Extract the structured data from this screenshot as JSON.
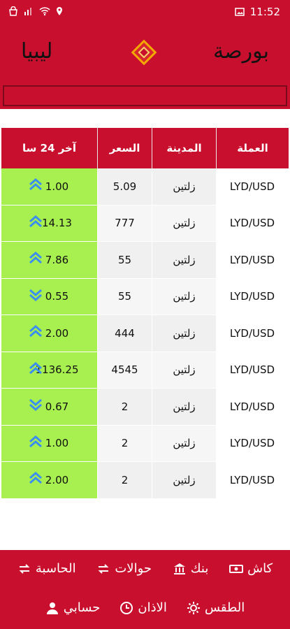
{
  "statusbar": {
    "time": "11:52"
  },
  "header": {
    "title_right": "بورصة",
    "title_left": "ليبيا"
  },
  "table": {
    "headers": {
      "currency": "العملة",
      "city": "المدينة",
      "price": "السعر",
      "change": "آخر 24 سا"
    },
    "rows": [
      {
        "currency": "LYD/USD",
        "city": "زلتين",
        "price": "5.09",
        "change": "1.00",
        "direction": "up"
      },
      {
        "currency": "LYD/USD",
        "city": "زلتين",
        "price": "777",
        "change": "14.13",
        "direction": "up"
      },
      {
        "currency": "LYD/USD",
        "city": "زلتين",
        "price": "55",
        "change": "7.86",
        "direction": "up"
      },
      {
        "currency": "LYD/USD",
        "city": "زلتين",
        "price": "55",
        "change": "0.55",
        "direction": "down"
      },
      {
        "currency": "LYD/USD",
        "city": "زلتين",
        "price": "444",
        "change": "2.00",
        "direction": "up"
      },
      {
        "currency": "LYD/USD",
        "city": "زلتين",
        "price": "4545",
        "change": "1136.25",
        "direction": "up"
      },
      {
        "currency": "LYD/USD",
        "city": "زلتين",
        "price": "2",
        "change": "0.67",
        "direction": "down"
      },
      {
        "currency": "LYD/USD",
        "city": "زلتين",
        "price": "2",
        "change": "1.00",
        "direction": "up"
      },
      {
        "currency": "LYD/USD",
        "city": "زلتين",
        "price": "2",
        "change": "2.00",
        "direction": "up"
      }
    ]
  },
  "nav": {
    "cash": "كاش",
    "bank": "بنك",
    "transfers": "حوالات",
    "calculator": "الحاسبة",
    "weather": "الطقس",
    "adhan": "الاذان",
    "account": "حسابي"
  },
  "colors": {
    "brand": "#c8102e",
    "change_bg": "#a7f04f",
    "arrow": "#3a8ff0"
  }
}
